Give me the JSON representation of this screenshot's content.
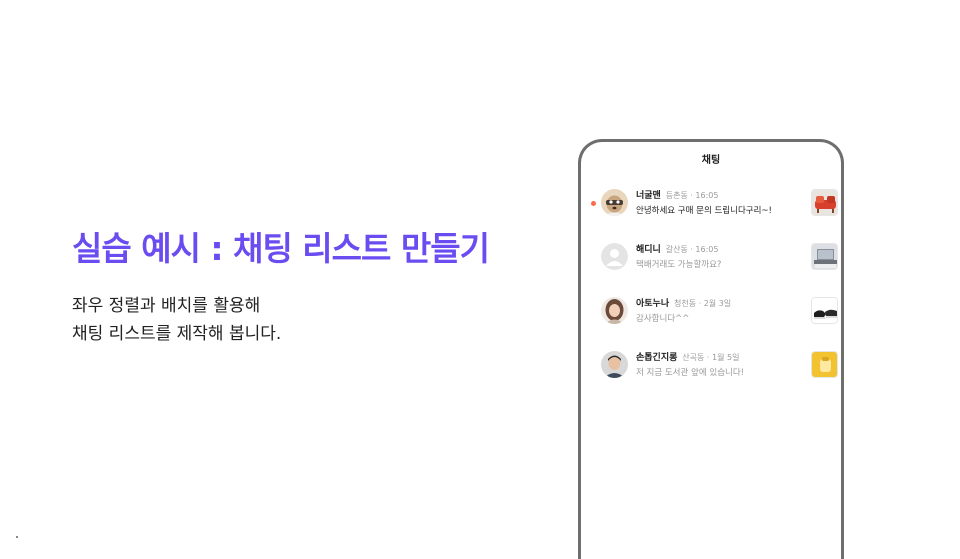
{
  "slide": {
    "title": "실습 예시 : 채팅 리스트 만들기",
    "description": [
      "좌우 정렬과 배치를 활용해",
      "채팅 리스트를 제작해 봅니다."
    ]
  },
  "colors": {
    "title": "#6a4cf0",
    "unread_dot": "#ff6b4a",
    "phone_border": "#6e6e6e"
  },
  "phone": {
    "header": "채팅",
    "chats": [
      {
        "name": "너굴맨",
        "meta": "등촌동 · 16:05",
        "message": "안녕하세요 구매 문의 드립니다구리~!",
        "unread": true,
        "avatar_icon": "raccoon-avatar-icon",
        "thumb_icon": "red-sofa-thumbnail-icon"
      },
      {
        "name": "해디니",
        "meta": "갈산동 · 16:05",
        "message": "택배거래도 가능할까요?",
        "unread": false,
        "avatar_icon": "default-avatar-icon",
        "thumb_icon": "laptop-thumbnail-icon"
      },
      {
        "name": "아토누나",
        "meta": "청천동 · 2월 3일",
        "message": "감사합니다^^",
        "unread": false,
        "avatar_icon": "woman-avatar-icon",
        "thumb_icon": "sneakers-thumbnail-icon"
      },
      {
        "name": "손톱긴지롱",
        "meta": "산곡동 · 1월 5일",
        "message": "저 지금 도서관 앞에 있습니다!",
        "unread": false,
        "avatar_icon": "man-avatar-icon",
        "thumb_icon": "yellow-pouch-thumbnail-icon"
      }
    ]
  }
}
